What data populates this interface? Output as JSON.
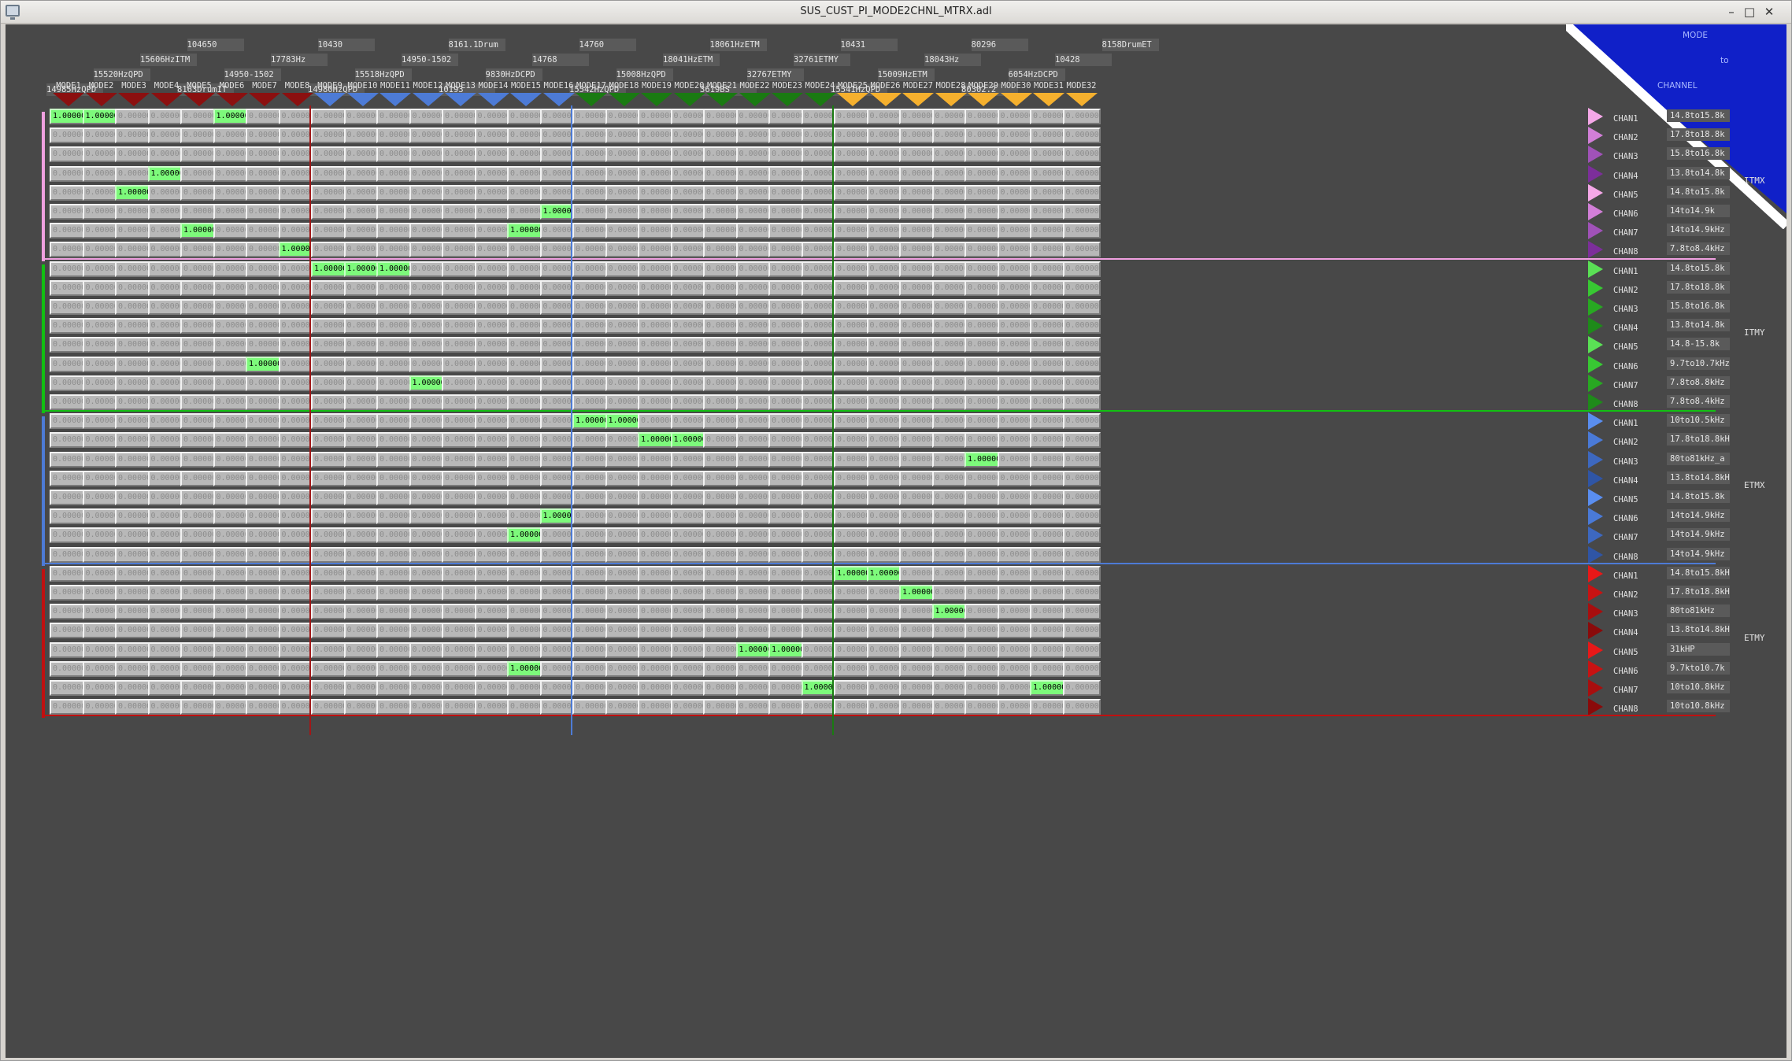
{
  "window": {
    "title": "SUS_CUST_PI_MODE2CHNL_MTRX.adl",
    "minimize": "–",
    "maximize": "□",
    "close": "✕"
  },
  "corner": {
    "line1": "MODE",
    "line2": "to",
    "line3": "CHANNEL"
  },
  "modes": [
    "MODE1",
    "MODE2",
    "MODE3",
    "MODE4",
    "MODE5",
    "MODE6",
    "MODE7",
    "MODE8",
    "MODE9",
    "MODE10",
    "MODE11",
    "MODE12",
    "MODE13",
    "MODE14",
    "MODE15",
    "MODE16",
    "MODE17",
    "MODE18",
    "MODE19",
    "MODE20",
    "MODE21",
    "MODE22",
    "MODE23",
    "MODE24",
    "MODE25",
    "MODE26",
    "MODE27",
    "MODE28",
    "MODE29",
    "MODE30",
    "MODE31",
    "MODE32"
  ],
  "mode_colors": [
    "#8b1010",
    "#8b1010",
    "#8b1010",
    "#8b1010",
    "#8b1010",
    "#8b1010",
    "#8b1010",
    "#8b1010",
    "#4d7bd6",
    "#4d7bd6",
    "#4d7bd6",
    "#4d7bd6",
    "#4d7bd6",
    "#4d7bd6",
    "#4d7bd6",
    "#4d7bd6",
    "#1a7a12",
    "#1a7a12",
    "#1a7a12",
    "#1a7a12",
    "#1a7a12",
    "#1a7a12",
    "#1a7a12",
    "#1a7a12",
    "#f5b02e",
    "#f5b02e",
    "#f5b02e",
    "#f5b02e",
    "#f5b02e",
    "#f5b02e",
    "#f5b02e",
    "#f5b02e"
  ],
  "mode_freqs": [
    "14985HzQPD",
    "15520HzQPD",
    "15606HzITM",
    "104650",
    "8163DrumIT",
    "14950-1502",
    "17783Hz",
    "10430",
    "14980HzQPD",
    "15518HzQPD",
    "14950-1502",
    "8161.1Drum",
    "10193",
    "9830HzDCPD",
    "14768",
    "14760",
    "15542HzQPD",
    "15008HzQPD",
    "18041HzETM",
    "18061HzETM",
    "3619BS",
    "32767ETMY",
    "32761ETMY",
    "10431",
    "15541HzQPD",
    "15009HzETM",
    "18043Hz",
    "80296",
    "80302.2",
    "6054HzDCPD",
    "10428",
    "8158DrumET"
  ],
  "groups": [
    {
      "name": "ITMX",
      "color": "#f0a0e0",
      "channels": [
        "CHAN1",
        "CHAN2",
        "CHAN3",
        "CHAN4",
        "CHAN5",
        "CHAN6",
        "CHAN7",
        "CHAN8"
      ],
      "tri_colors": [
        "#f5a8e8",
        "#d27fd8",
        "#a052b8",
        "#7c2e9a",
        "#f5a8e8",
        "#d27fd8",
        "#a052b8",
        "#7c2e9a"
      ],
      "filters": [
        "14.8to15.8k",
        "17.8to18.8k",
        "15.8to16.8k",
        "13.8to14.8k",
        "14.8to15.8k",
        "14to14.9k",
        "14to14.9kHz",
        "7.8to8.4kHz"
      ]
    },
    {
      "name": "ITMY",
      "color": "#12c012",
      "channels": [
        "CHAN1",
        "CHAN2",
        "CHAN3",
        "CHAN4",
        "CHAN5",
        "CHAN6",
        "CHAN7",
        "CHAN8"
      ],
      "tri_colors": [
        "#5ae055",
        "#38c833",
        "#28a822",
        "#1e8a1a",
        "#5ae055",
        "#38c833",
        "#28a822",
        "#1e8a1a"
      ],
      "filters": [
        "14.8to15.8k",
        "17.8to18.8k",
        "15.8to16.8k",
        "13.8to14.8k",
        "14.8-15.8k",
        "9.7to10.7kHz",
        "7.8to8.8kHz",
        "7.8to8.4kHz"
      ]
    },
    {
      "name": "ETMX",
      "color": "#4d7bd6",
      "channels": [
        "CHAN1",
        "CHAN2",
        "CHAN3",
        "CHAN4",
        "CHAN5",
        "CHAN6",
        "CHAN7",
        "CHAN8"
      ],
      "tri_colors": [
        "#5a8ef0",
        "#4a7ad8",
        "#3d68c0",
        "#2f55a5",
        "#5a8ef0",
        "#4a7ad8",
        "#3d68c0",
        "#2f55a5"
      ],
      "filters": [
        "10to10.5kHz",
        "17.8to18.8kHz",
        "80to81kHz_a",
        "13.8to14.8kHz",
        "14.8to15.8k",
        "14to14.9kHz",
        "14to14.9kHz",
        "14to14.9kHz"
      ]
    },
    {
      "name": "ETMY",
      "color": "#c01010",
      "channels": [
        "CHAN1",
        "CHAN2",
        "CHAN3",
        "CHAN4",
        "CHAN5",
        "CHAN6",
        "CHAN7",
        "CHAN8"
      ],
      "tri_colors": [
        "#e81818",
        "#c81212",
        "#a80e0e",
        "#8a0a0a",
        "#e81818",
        "#c81212",
        "#a80e0e",
        "#8a0a0a"
      ],
      "filters": [
        "14.8to15.8kHz",
        "17.8to18.8kHz",
        "80to81kHz",
        "13.8to14.8kHz",
        "31kHP",
        "9.7kto10.7k",
        "10to10.8kHz",
        "10to10.8kHz"
      ]
    }
  ],
  "matrix": {
    "default_value": "0.00000",
    "on_value": "1.00000",
    "on_cells": [
      [
        0,
        0
      ],
      [
        0,
        1
      ],
      [
        0,
        5
      ],
      [
        3,
        3
      ],
      [
        4,
        2
      ],
      [
        5,
        15
      ],
      [
        6,
        4
      ],
      [
        6,
        14
      ],
      [
        7,
        7
      ],
      [
        8,
        8
      ],
      [
        8,
        9
      ],
      [
        8,
        10
      ],
      [
        13,
        6
      ],
      [
        14,
        11
      ],
      [
        16,
        16
      ],
      [
        16,
        17
      ],
      [
        17,
        18
      ],
      [
        17,
        19
      ],
      [
        18,
        28
      ],
      [
        21,
        15
      ],
      [
        22,
        14
      ],
      [
        24,
        24
      ],
      [
        24,
        25
      ],
      [
        25,
        26
      ],
      [
        26,
        27
      ],
      [
        28,
        21
      ],
      [
        28,
        22
      ],
      [
        29,
        14
      ],
      [
        30,
        23
      ],
      [
        30,
        30
      ]
    ]
  }
}
